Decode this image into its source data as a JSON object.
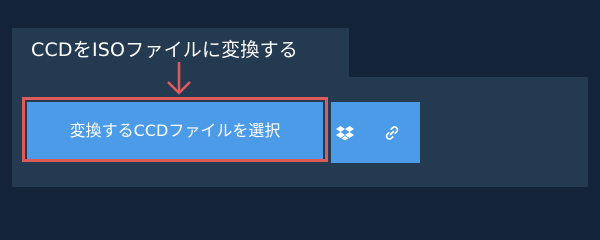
{
  "header": {
    "title": "CCDをISOファイルに変換する"
  },
  "upload": {
    "button_label": "変換するCCDファイルを選択",
    "dropbox_icon": "dropbox-icon",
    "link_icon": "link-icon"
  },
  "colors": {
    "background": "#13243a",
    "panel": "#243a51",
    "button": "#4c9be8",
    "highlight": "#e05a5a"
  }
}
